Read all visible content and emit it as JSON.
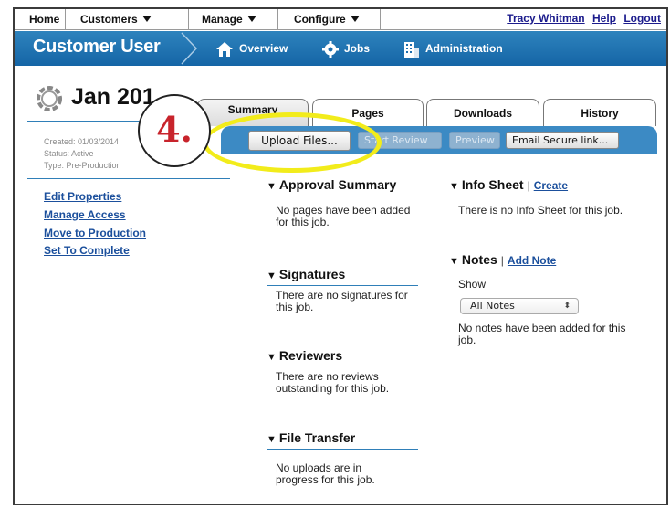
{
  "topmenu": {
    "home": "Home",
    "customers": "Customers",
    "manage": "Manage",
    "configure": "Configure",
    "user_name": "Tracy Whitman",
    "help": "Help",
    "logout": "Logout"
  },
  "bluebar": {
    "title": "Customer User",
    "overview": "Overview",
    "jobs": "Jobs",
    "administration": "Administration"
  },
  "job": {
    "title": "Jan 201",
    "created": "Created: 01/03/2014",
    "status": "Status: Active",
    "type": "Type: Pre-Production"
  },
  "tabs": [
    "Summary",
    "Pages",
    "Downloads",
    "History"
  ],
  "toolbar": {
    "upload": "Upload Files...",
    "start_review": "Start Review",
    "preview": "Preview",
    "email": "Email Secure link..."
  },
  "sidebar_links": [
    "Edit Properties",
    "Manage Access",
    "Move to Production",
    "Set To Complete"
  ],
  "sections": {
    "approval": {
      "title": "Approval Summary",
      "text": "No pages have been added for this job."
    },
    "signatures": {
      "title": "Signatures",
      "text": "There are no signatures for this job."
    },
    "reviewers": {
      "title": "Reviewers",
      "text": "There are no reviews outstanding for this job."
    },
    "file_transfer": {
      "title": "File Transfer",
      "text": "No uploads are in progress for this job."
    },
    "info_sheet": {
      "title": "Info Sheet",
      "link": "Create",
      "text": "There is no Info Sheet for this job."
    },
    "notes": {
      "title": "Notes",
      "link": "Add Note",
      "show_label": "Show",
      "select_value": "All Notes",
      "text": "No notes have been added for this job."
    }
  },
  "annotation": {
    "step": "4."
  },
  "colors": {
    "brand_blue": "#1f6fae",
    "link_blue": "#1b4f9c",
    "highlight": "#f2ec1b",
    "annotation_red": "#c8242c"
  }
}
